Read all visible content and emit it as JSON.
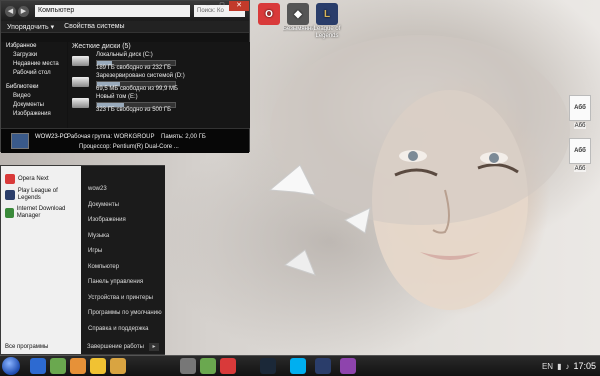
{
  "wallpaper": {
    "subject": "portrait"
  },
  "desktop_icons": [
    {
      "label": "",
      "icon": "opera-icon",
      "color": "#d93a3a"
    },
    {
      "label": "Безымянный",
      "icon": "games-icon",
      "color": "#555555"
    },
    {
      "label": "League of Legends",
      "icon": "league-icon",
      "color": "#2a3d6a"
    }
  ],
  "desktop_files": [
    {
      "label": "Абб",
      "doc": "Абб"
    },
    {
      "label": "Абб",
      "doc": "Абб"
    }
  ],
  "explorer": {
    "address": "Компьютер",
    "search_placeholder": "Поиск: Ко",
    "toolbar": {
      "organize": "Упорядочить ▾",
      "system_props": "Свойства системы"
    },
    "nav": {
      "favorites_header": "Избранное",
      "favorites": [
        "Загрузки",
        "Недавние места",
        "Рабочий стол"
      ],
      "libraries_header": "Библиотеки",
      "libraries": [
        "Видео",
        "Документы",
        "Изображения"
      ]
    },
    "section_title": "Жесткие диски (5)",
    "drives": [
      {
        "name": "Локальный диск (C:)",
        "free": "189 ГБ свободно из 232 ГБ",
        "used": 0.19
      },
      {
        "name": "Зарезервировано системой (D:)",
        "free": "69,5 МБ свободно из 99,9 МБ",
        "used": 0.3
      },
      {
        "name": "Новый том (E:)",
        "free": "323 ГБ свободно из 500 ГБ",
        "used": 0.35
      }
    ],
    "details": {
      "pc_name": "WOW23-PC",
      "workgroup": "Рабочая группа: WORKGROUP",
      "memory": "Память: 2,00 ГБ",
      "processor": "Процессор: Pentium(R) Dual-Core ..."
    }
  },
  "start_menu": {
    "left_items": [
      "Opera Next",
      "Play League of Legends",
      "Internet Download Manager"
    ],
    "all_programs": "Все программы",
    "right_links": [
      "wow23",
      "Документы",
      "Изображения",
      "Музыка",
      "Игры",
      "Компьютер",
      "Панель управления",
      "Устройства и принтеры",
      "Программы по умолчанию",
      "Справка и поддержка"
    ],
    "shutdown": "Завершение работы"
  },
  "taskbar": {
    "icons": [
      "ie-icon",
      "utorrent-icon",
      "aimp-icon",
      "media-icon",
      "folder-icon",
      "explorer-icon",
      "utorrent2-icon",
      "opera-icon",
      "steam-icon",
      "skype-icon",
      "league-icon",
      "winrar-icon"
    ],
    "lang": "EN",
    "time": "17:05"
  }
}
